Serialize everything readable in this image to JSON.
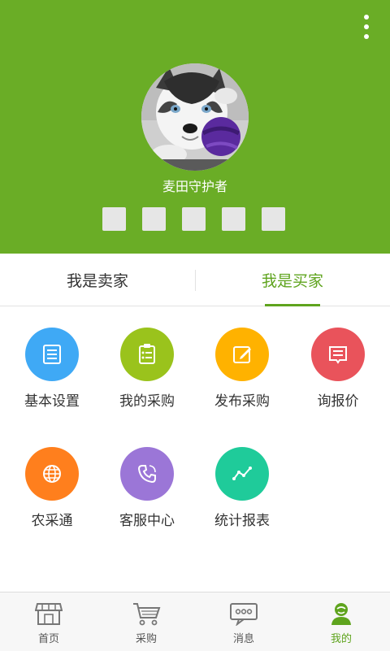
{
  "profile": {
    "nickname": "麦田守护者",
    "badges": [
      "",
      "",
      "",
      "",
      ""
    ]
  },
  "tabs": [
    {
      "label": "我是卖家",
      "active": false
    },
    {
      "label": "我是买家",
      "active": true
    }
  ],
  "grid": [
    {
      "label": "基本设置",
      "icon": "settings-doc-icon",
      "color": "#3fa9f5"
    },
    {
      "label": "我的采购",
      "icon": "clipboard-list-icon",
      "color": "#9ac31c"
    },
    {
      "label": "发布采购",
      "icon": "edit-note-icon",
      "color": "#ffb200"
    },
    {
      "label": "询报价",
      "icon": "message-icon",
      "color": "#e9535b"
    },
    {
      "label": "农采通",
      "icon": "globe-icon",
      "color": "#ff7f1d"
    },
    {
      "label": "客服中心",
      "icon": "phone-icon",
      "color": "#9b76d7"
    },
    {
      "label": "统计报表",
      "icon": "chart-line-icon",
      "color": "#1fcb9a"
    }
  ],
  "bottom_nav": [
    {
      "label": "首页",
      "icon": "store-icon",
      "active": false
    },
    {
      "label": "采购",
      "icon": "cart-icon",
      "active": false
    },
    {
      "label": "消息",
      "icon": "chat-icon",
      "active": false
    },
    {
      "label": "我的",
      "icon": "user-icon",
      "active": true
    }
  ]
}
